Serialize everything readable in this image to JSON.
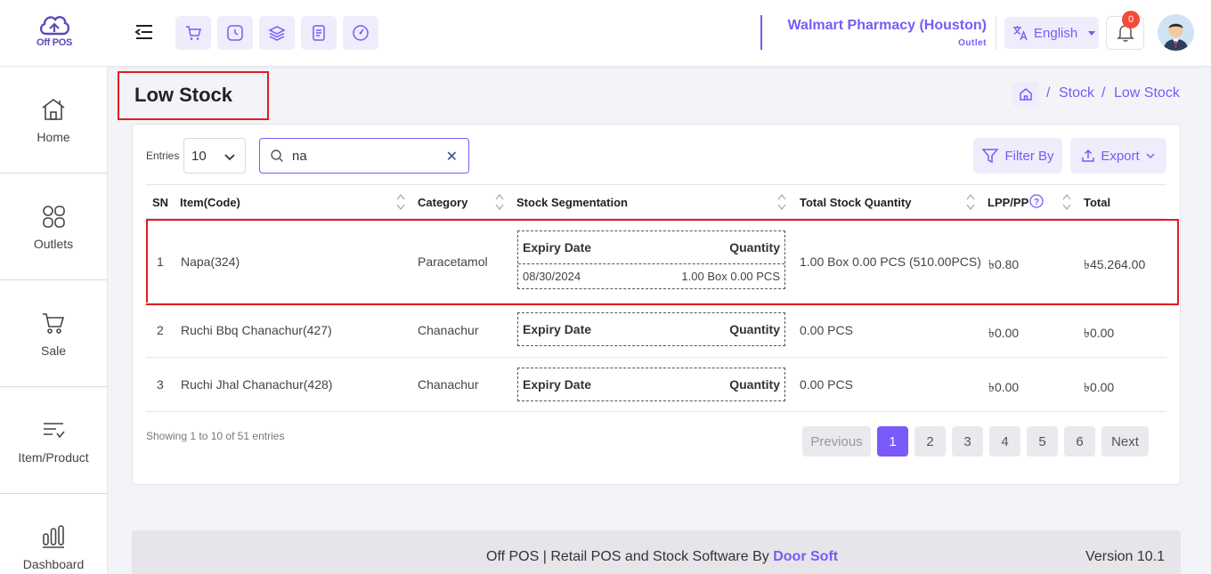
{
  "app": {
    "logo_text": "Off POS"
  },
  "header": {
    "outlet_name": "Walmart Pharmacy (Houston)",
    "outlet_sub": "Outlet",
    "language": "English",
    "notification_count": "0"
  },
  "sidebar": {
    "items": [
      {
        "label": "Home",
        "icon": "home-icon"
      },
      {
        "label": "Outlets",
        "icon": "outlets-icon"
      },
      {
        "label": "Sale",
        "icon": "cart-icon"
      },
      {
        "label": "Item/Product",
        "icon": "list-icon"
      },
      {
        "label": "Dashboard",
        "icon": "chart-icon"
      }
    ]
  },
  "page": {
    "title": "Low Stock",
    "breadcrumb": [
      "Stock",
      "Low Stock"
    ]
  },
  "controls": {
    "entries_label": "Entries",
    "entries_value": "10",
    "search_value": "na",
    "filter_label": "Filter By",
    "export_label": "Export"
  },
  "table": {
    "columns": [
      "SN",
      "Item(Code)",
      "Category",
      "Stock Segmentation",
      "Total Stock Quantity",
      "LPP/PP",
      "Total"
    ],
    "seg_headers": {
      "expiry": "Expiry Date",
      "quantity": "Quantity"
    },
    "rows": [
      {
        "sn": "1",
        "item": "Napa(324)",
        "category": "Paracetamol",
        "seg_date": "08/30/2024",
        "seg_qty": "1.00 Box 0.00 PCS",
        "total_qty": "1.00 Box 0.00 PCS (510.00PCS)",
        "lpp": "৳0.80",
        "total": "৳45.264.00"
      },
      {
        "sn": "2",
        "item": "Ruchi Bbq Chanachur(427)",
        "category": "Chanachur",
        "total_qty": "0.00 PCS",
        "lpp": "৳0.00",
        "total": "৳0.00"
      },
      {
        "sn": "3",
        "item": "Ruchi Jhal Chanachur(428)",
        "category": "Chanachur",
        "total_qty": "0.00 PCS",
        "lpp": "৳0.00",
        "total": "৳0.00"
      }
    ]
  },
  "pagination": {
    "info": "Showing 1 to 10 of 51 entries",
    "previous": "Previous",
    "next": "Next",
    "pages": [
      "1",
      "2",
      "3",
      "4",
      "5",
      "6"
    ],
    "current": "1"
  },
  "footer": {
    "text": "Off POS | Retail POS and Stock Software By ",
    "brand": "Door Soft",
    "version": "Version 10.1"
  },
  "colors": {
    "accent": "#7a5af8",
    "highlight": "#e31b23",
    "badge": "#f44a3b"
  }
}
